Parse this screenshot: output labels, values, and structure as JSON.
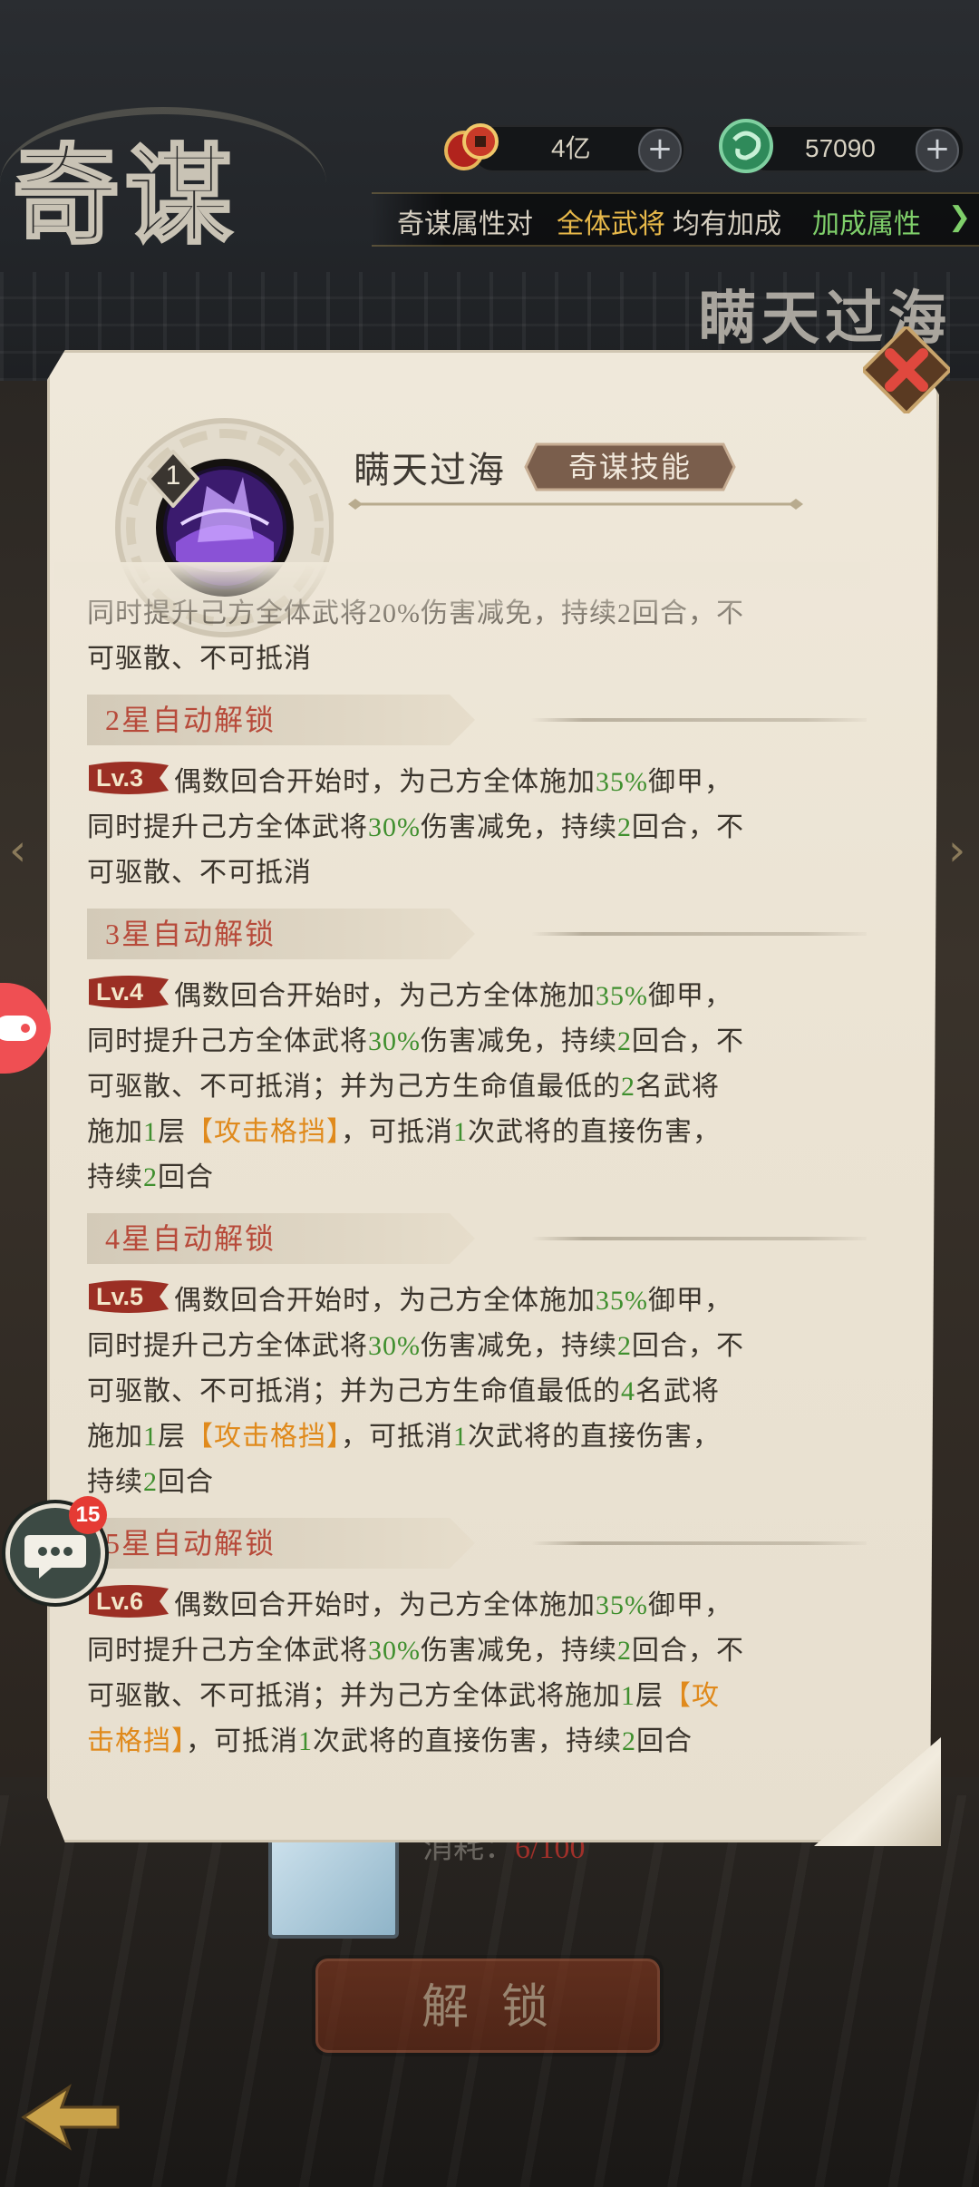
{
  "header": {
    "title": "奇谋",
    "resources": [
      {
        "name": "coin",
        "value": "4亿"
      },
      {
        "name": "jade",
        "value": "57090"
      }
    ],
    "attr_notice": {
      "prefix": "奇谋属性对",
      "highlight": "全体武将",
      "suffix": "均有加成",
      "link": "加成属性"
    },
    "background_skill_name": "瞒天过海"
  },
  "popup": {
    "skill_level_badge": "1",
    "skill_name": "瞒天过海",
    "skill_tag": "奇谋技能",
    "partial_top": {
      "line1": "同时提升己方全体武将20%伤害减免，持续2回合，不",
      "line2": "可驱散、不可抵消"
    },
    "sections": [
      {
        "header": "2星自动解锁",
        "level": "Lv.3",
        "lines": [
          [
            {
              "t": "偶数回合开始时，为己方全体施加"
            },
            {
              "t": "35%",
              "c": "g"
            },
            {
              "t": "御甲，"
            }
          ],
          [
            {
              "t": "同时提升己方全体武将"
            },
            {
              "t": "30%",
              "c": "g"
            },
            {
              "t": "伤害减免，持续"
            },
            {
              "t": "2",
              "c": "g"
            },
            {
              "t": "回合，不"
            }
          ],
          [
            {
              "t": "可驱散、不可抵消"
            }
          ]
        ]
      },
      {
        "header": "3星自动解锁",
        "level": "Lv.4",
        "lines": [
          [
            {
              "t": "偶数回合开始时，为己方全体施加"
            },
            {
              "t": "35%",
              "c": "g"
            },
            {
              "t": "御甲，"
            }
          ],
          [
            {
              "t": "同时提升己方全体武将"
            },
            {
              "t": "30%",
              "c": "g"
            },
            {
              "t": "伤害减免，持续"
            },
            {
              "t": "2",
              "c": "g"
            },
            {
              "t": "回合，不"
            }
          ],
          [
            {
              "t": "可驱散、不可抵消；并为己方生命值最低的"
            },
            {
              "t": "2",
              "c": "g"
            },
            {
              "t": "名武将"
            }
          ],
          [
            {
              "t": "施加"
            },
            {
              "t": "1",
              "c": "g"
            },
            {
              "t": "层"
            },
            {
              "t": "【攻击格挡】",
              "c": "o"
            },
            {
              "t": "，可抵消"
            },
            {
              "t": "1",
              "c": "g"
            },
            {
              "t": "次武将的直接伤害，"
            }
          ],
          [
            {
              "t": "持续"
            },
            {
              "t": "2",
              "c": "g"
            },
            {
              "t": "回合"
            }
          ]
        ]
      },
      {
        "header": "4星自动解锁",
        "level": "Lv.5",
        "lines": [
          [
            {
              "t": "偶数回合开始时，为己方全体施加"
            },
            {
              "t": "35%",
              "c": "g"
            },
            {
              "t": "御甲，"
            }
          ],
          [
            {
              "t": "同时提升己方全体武将"
            },
            {
              "t": "30%",
              "c": "g"
            },
            {
              "t": "伤害减免，持续"
            },
            {
              "t": "2",
              "c": "g"
            },
            {
              "t": "回合，不"
            }
          ],
          [
            {
              "t": "可驱散、不可抵消；并为己方生命值最低的"
            },
            {
              "t": "4",
              "c": "g"
            },
            {
              "t": "名武将"
            }
          ],
          [
            {
              "t": "施加"
            },
            {
              "t": "1",
              "c": "g"
            },
            {
              "t": "层"
            },
            {
              "t": "【攻击格挡】",
              "c": "o"
            },
            {
              "t": "，可抵消"
            },
            {
              "t": "1",
              "c": "g"
            },
            {
              "t": "次武将的直接伤害，"
            }
          ],
          [
            {
              "t": "持续"
            },
            {
              "t": "2",
              "c": "g"
            },
            {
              "t": "回合"
            }
          ]
        ]
      },
      {
        "header": "5星自动解锁",
        "level": "Lv.6",
        "lines": [
          [
            {
              "t": "偶数回合开始时，为己方全体施加"
            },
            {
              "t": "35%",
              "c": "g"
            },
            {
              "t": "御甲，"
            }
          ],
          [
            {
              "t": "同时提升己方全体武将"
            },
            {
              "t": "30%",
              "c": "g"
            },
            {
              "t": "伤害减免，持续"
            },
            {
              "t": "2",
              "c": "g"
            },
            {
              "t": "回合，不"
            }
          ],
          [
            {
              "t": "可驱散、不可抵消；并为己方全体武将施加"
            },
            {
              "t": "1",
              "c": "g"
            },
            {
              "t": "层"
            },
            {
              "t": "【攻",
              "c": "o"
            }
          ],
          [
            {
              "t": "击格挡】",
              "c": "o"
            },
            {
              "t": "，可抵消"
            },
            {
              "t": "1",
              "c": "g"
            },
            {
              "t": "次武将的直接伤害，持续"
            },
            {
              "t": "2",
              "c": "g"
            },
            {
              "t": "回合"
            }
          ]
        ]
      }
    ]
  },
  "bottom": {
    "consume_label": "消耗：",
    "consume_value": "6/100",
    "unlock_button": "解锁"
  },
  "floating": {
    "chat_badge": "15"
  },
  "colors": {
    "green_value": "#3f8f2e",
    "orange_value": "#e08a1c",
    "section_header_text": "#b74a3a"
  }
}
